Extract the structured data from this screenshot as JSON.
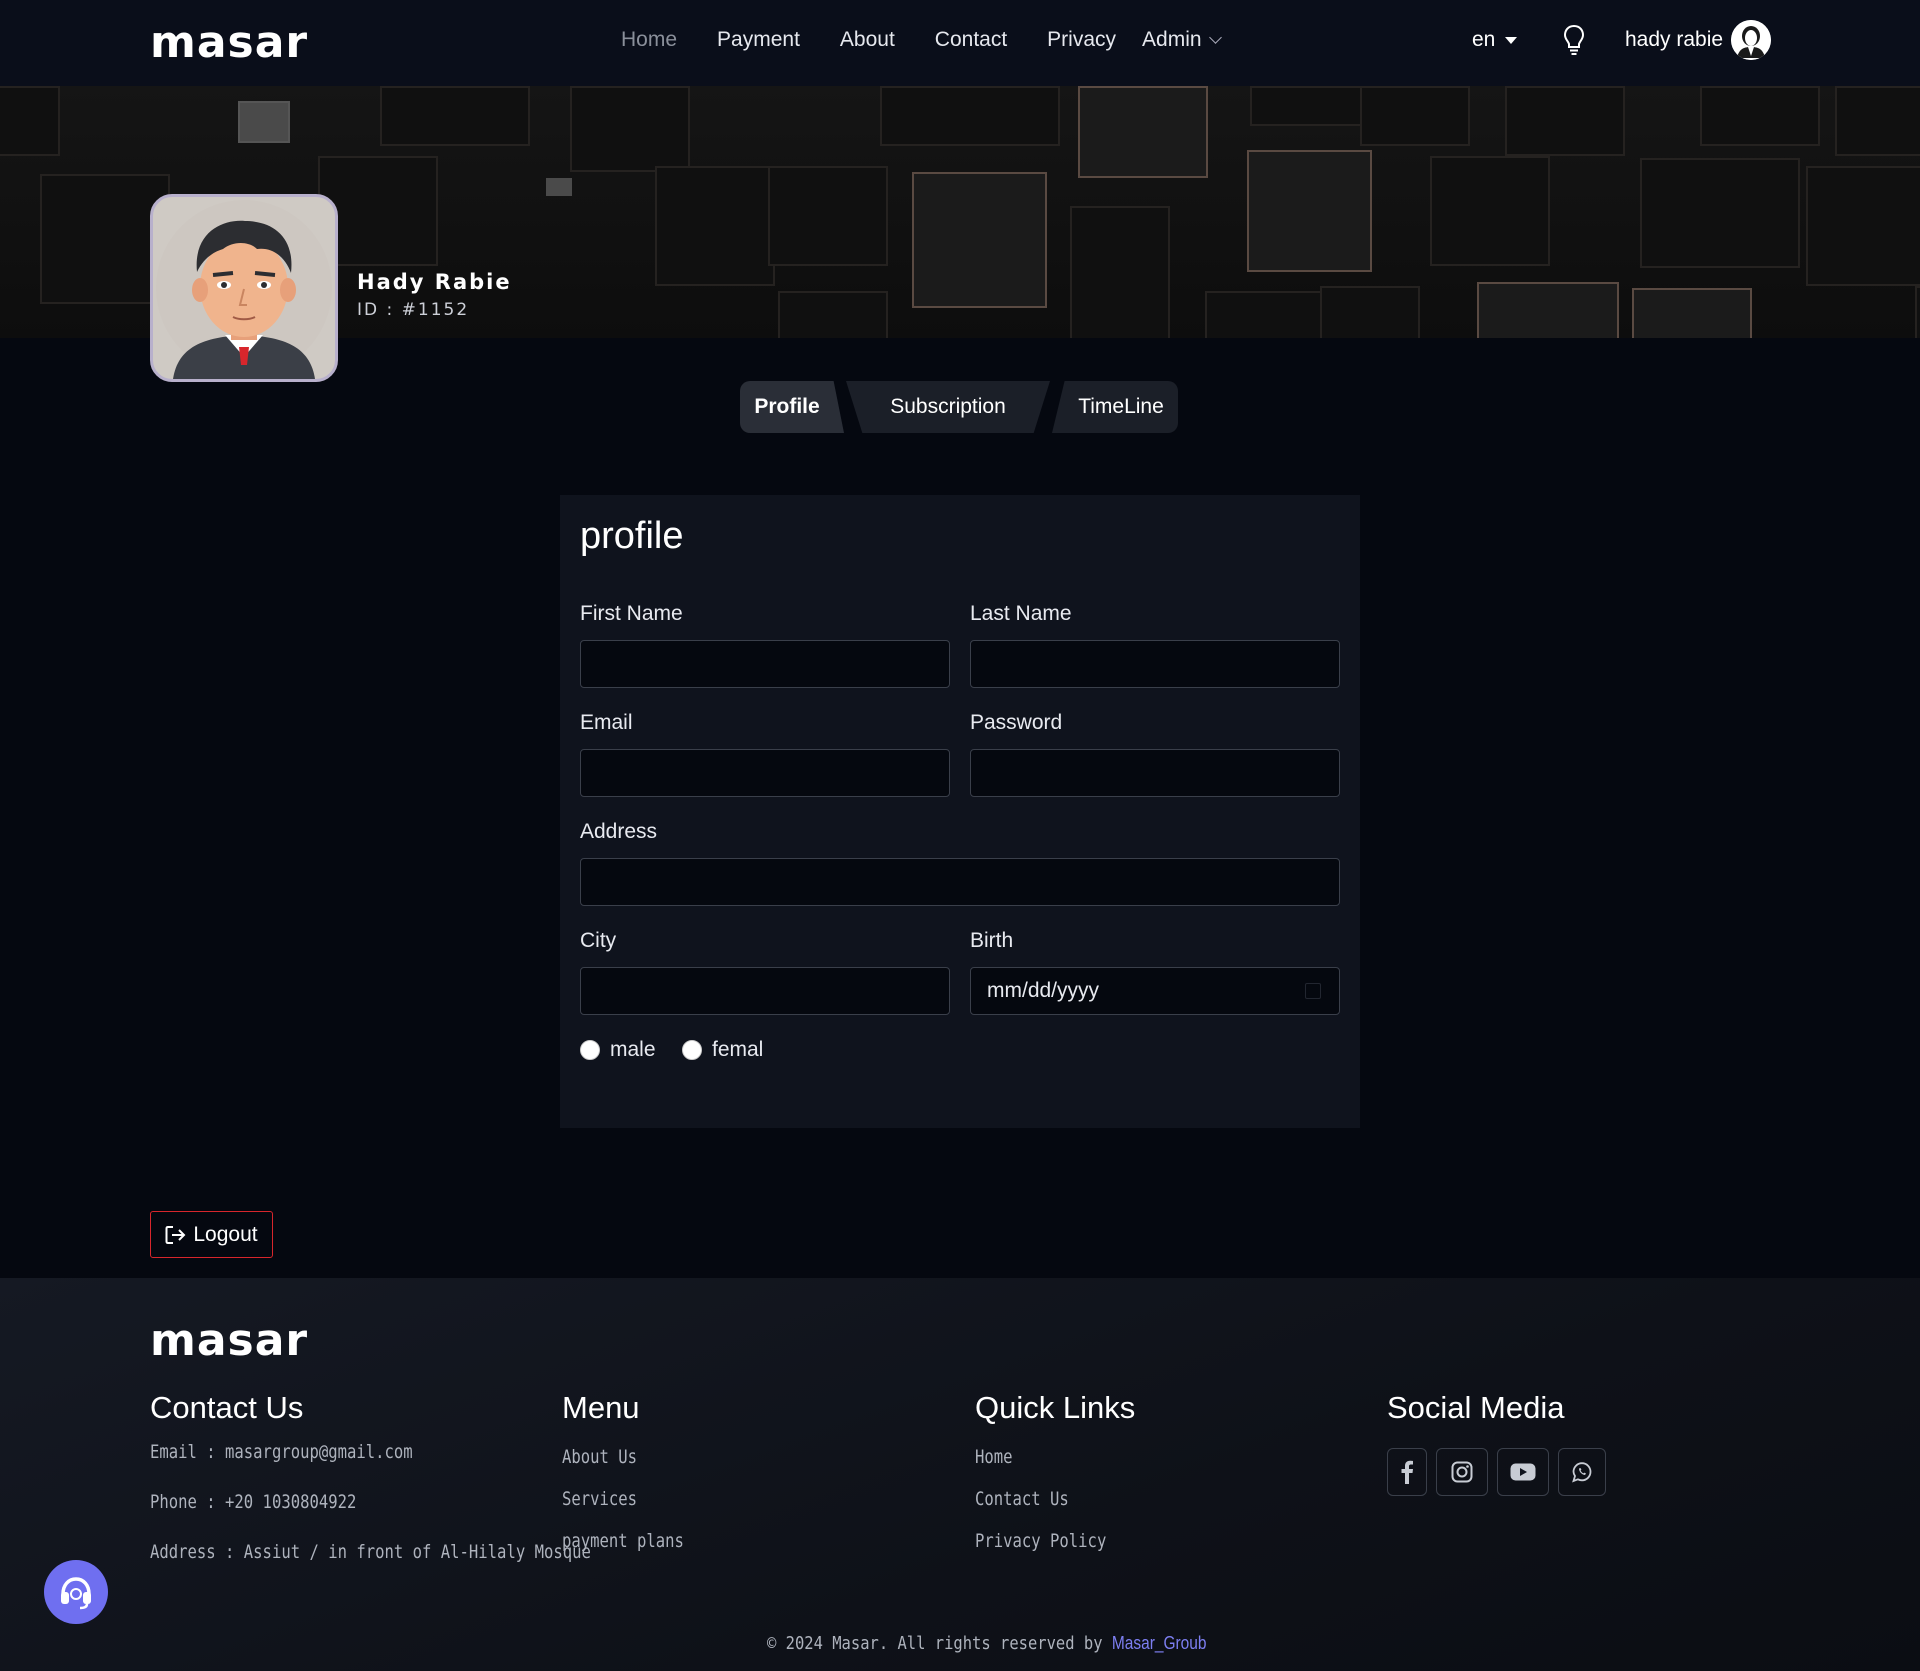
{
  "nav": {
    "logo": "masar",
    "links": [
      "Home",
      "Payment",
      "About",
      "Contact",
      "Privacy"
    ],
    "admin": "Admin",
    "lang": "en",
    "user_name": "hady rabie"
  },
  "profile_header": {
    "name": "Hady Rabie",
    "id": "ID : #1152"
  },
  "tabs": [
    "Profile",
    "Subscription",
    "TimeLine"
  ],
  "form": {
    "title": "profile",
    "first_name_label": "First Name",
    "last_name_label": "Last Name",
    "email_label": "Email",
    "password_label": "Password",
    "address_label": "Address",
    "city_label": "City",
    "birth_label": "Birth",
    "birth_placeholder": "mm/dd/yyyy",
    "gender_options": [
      "male",
      "femal"
    ]
  },
  "logout_label": "Logout",
  "footer": {
    "logo": "masar",
    "contact_heading": "Contact Us",
    "contact_email": "Email : masargroup@gmail.com",
    "contact_phone": "Phone : +20 1030804922",
    "contact_address": "Address : Assiut / in front of Al-Hilaly Mosque",
    "menu_heading": "Menu",
    "menu_items": [
      "About Us",
      "Services",
      "payment plans"
    ],
    "quick_heading": "Quick Links",
    "quick_items": [
      "Home",
      "Contact Us",
      "Privacy Policy"
    ],
    "social_heading": "Social Media",
    "social_icons": [
      "facebook-icon",
      "instagram-icon",
      "youtube-icon",
      "whatsapp-icon"
    ],
    "copyright": "© 2024 Masar. All rights reserved by",
    "copyright_brand": "Masar_Groub"
  },
  "colors": {
    "background": "#050810",
    "logout_border": "#d8262c",
    "brand_link": "#7d7ff2",
    "support_button": "#6f6ff0"
  }
}
